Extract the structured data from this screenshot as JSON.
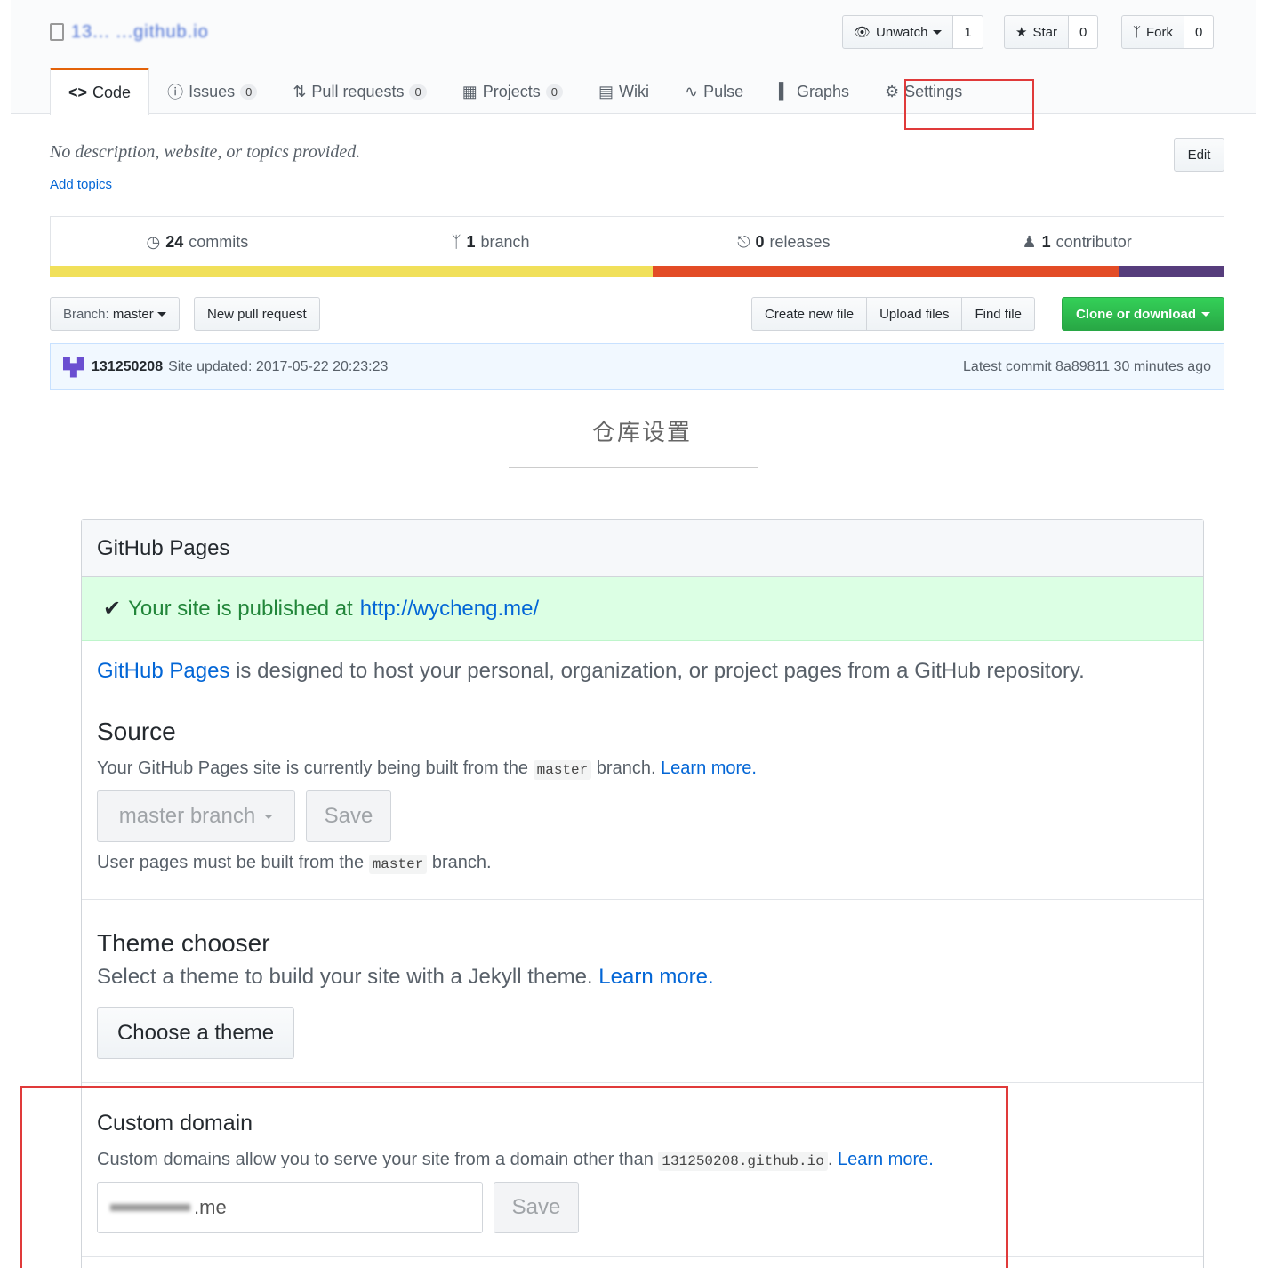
{
  "repo": {
    "name": "13... ...github.io",
    "actions": [
      {
        "label": "Unwatch",
        "count": "1"
      },
      {
        "label": "Star",
        "count": "0"
      },
      {
        "label": "Fork",
        "count": "0"
      }
    ],
    "tabs": [
      {
        "label": "Code"
      },
      {
        "label": "Issues",
        "count": "0"
      },
      {
        "label": "Pull requests",
        "count": "0"
      },
      {
        "label": "Projects",
        "count": "0"
      },
      {
        "label": "Wiki"
      },
      {
        "label": "Pulse"
      },
      {
        "label": "Graphs"
      },
      {
        "label": "Settings"
      }
    ],
    "description": "No description, website, or topics provided.",
    "add_topics": "Add topics",
    "edit_label": "Edit",
    "summary": {
      "commits_count": "24",
      "commits_label": "commits",
      "branch_count": "1",
      "branch_label": "branch",
      "releases_count": "0",
      "releases_label": "releases",
      "contributor_count": "1",
      "contributor_label": "contributor"
    },
    "languages": [
      {
        "color": "#f1e05a",
        "share": 51.3
      },
      {
        "color": "#e34c26",
        "share": 39.7
      },
      {
        "color": "#563d7c",
        "share": 9.0
      }
    ],
    "branch_select_prefix": "Branch:",
    "branch_select_value": "master",
    "new_pr": "New pull request",
    "file_buttons": [
      "Create new file",
      "Upload files",
      "Find file"
    ],
    "clone": "Clone or download",
    "commit": {
      "author": "131250208",
      "message": "Site updated: 2017-05-22 20:23:23",
      "latest": "Latest commit 8a89811 30 minutes ago"
    }
  },
  "caption": "仓库设置",
  "pages": {
    "title": "GitHub Pages",
    "published_prefix": "Your site is published at",
    "published_url": "http://wycheng.me/",
    "intro_link": "GitHub Pages",
    "intro_rest": " is designed to host your personal, organization, or project pages from a GitHub repository.",
    "source": {
      "heading": "Source",
      "note_pre": "Your GitHub Pages site is currently being built from the ",
      "code": "master",
      "note_post": " branch. ",
      "learn": "Learn more.",
      "select": "master branch",
      "save": "Save",
      "hint_pre": "User pages must be built from the ",
      "hint_code": "master",
      "hint_post": " branch."
    },
    "theme": {
      "heading": "Theme chooser",
      "note": "Select a theme to build your site with a Jekyll theme. ",
      "learn": "Learn more.",
      "button": "Choose a theme"
    },
    "domain": {
      "heading": "Custom domain",
      "note": "Custom domains allow you to serve your site from a domain other than ",
      "code": "131250208.github.io",
      "learn": "Learn more.",
      "value": ".me",
      "save": "Save"
    }
  },
  "colors": {
    "accent": "#0366d6",
    "success": "#28a745",
    "highlight": "#e03a3a"
  }
}
